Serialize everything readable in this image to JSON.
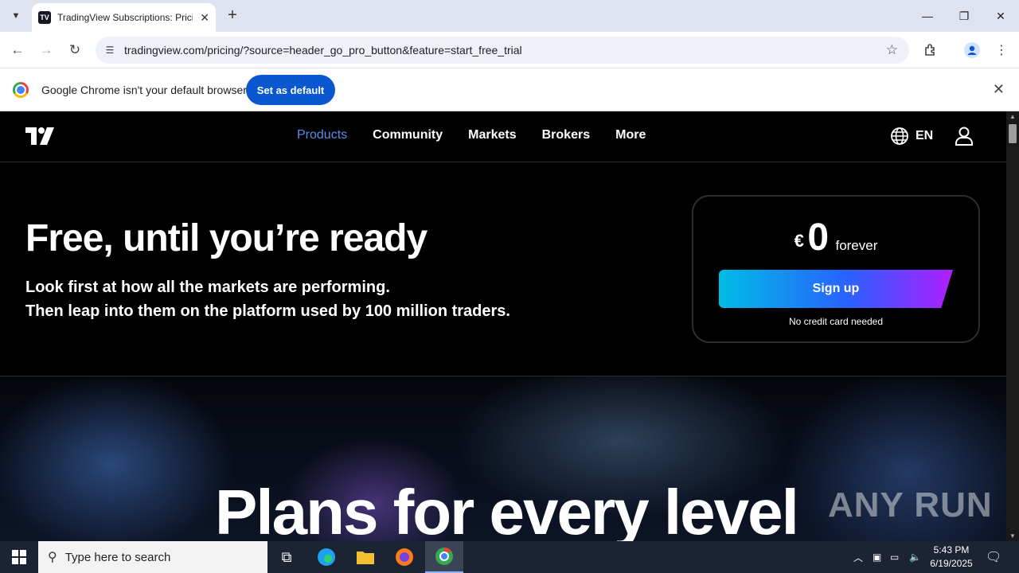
{
  "browser": {
    "tab_title": "TradingView Subscriptions: Pricing",
    "url": "tradingview.com/pricing/?source=header_go_pro_button&feature=start_free_trial"
  },
  "infobar": {
    "message": "Google Chrome isn't your default browser",
    "button": "Set as default"
  },
  "tv": {
    "nav": [
      "Products",
      "Community",
      "Markets",
      "Brokers",
      "More"
    ],
    "lang": "EN",
    "hero_title": "Free, until you’re ready",
    "hero_sub_1": "Look first at how all the markets are performing.",
    "hero_sub_2": "Then leap into them on the platform used by 100 million traders.",
    "currency": "€",
    "price": "0",
    "period": "forever",
    "signup": "Sign up",
    "nocc": "No credit card needed",
    "plans_title": "Plans for every level",
    "watermark": "ANY RUN"
  },
  "taskbar": {
    "search_placeholder": "Type here to search",
    "time": "5:43 PM",
    "date": "6/19/2025"
  },
  "colors": {
    "nav_active": "#5b8def",
    "signup_gradient_start": "#00bce5",
    "signup_gradient_end": "#b01eff",
    "chrome_button": "#0b57d0"
  }
}
